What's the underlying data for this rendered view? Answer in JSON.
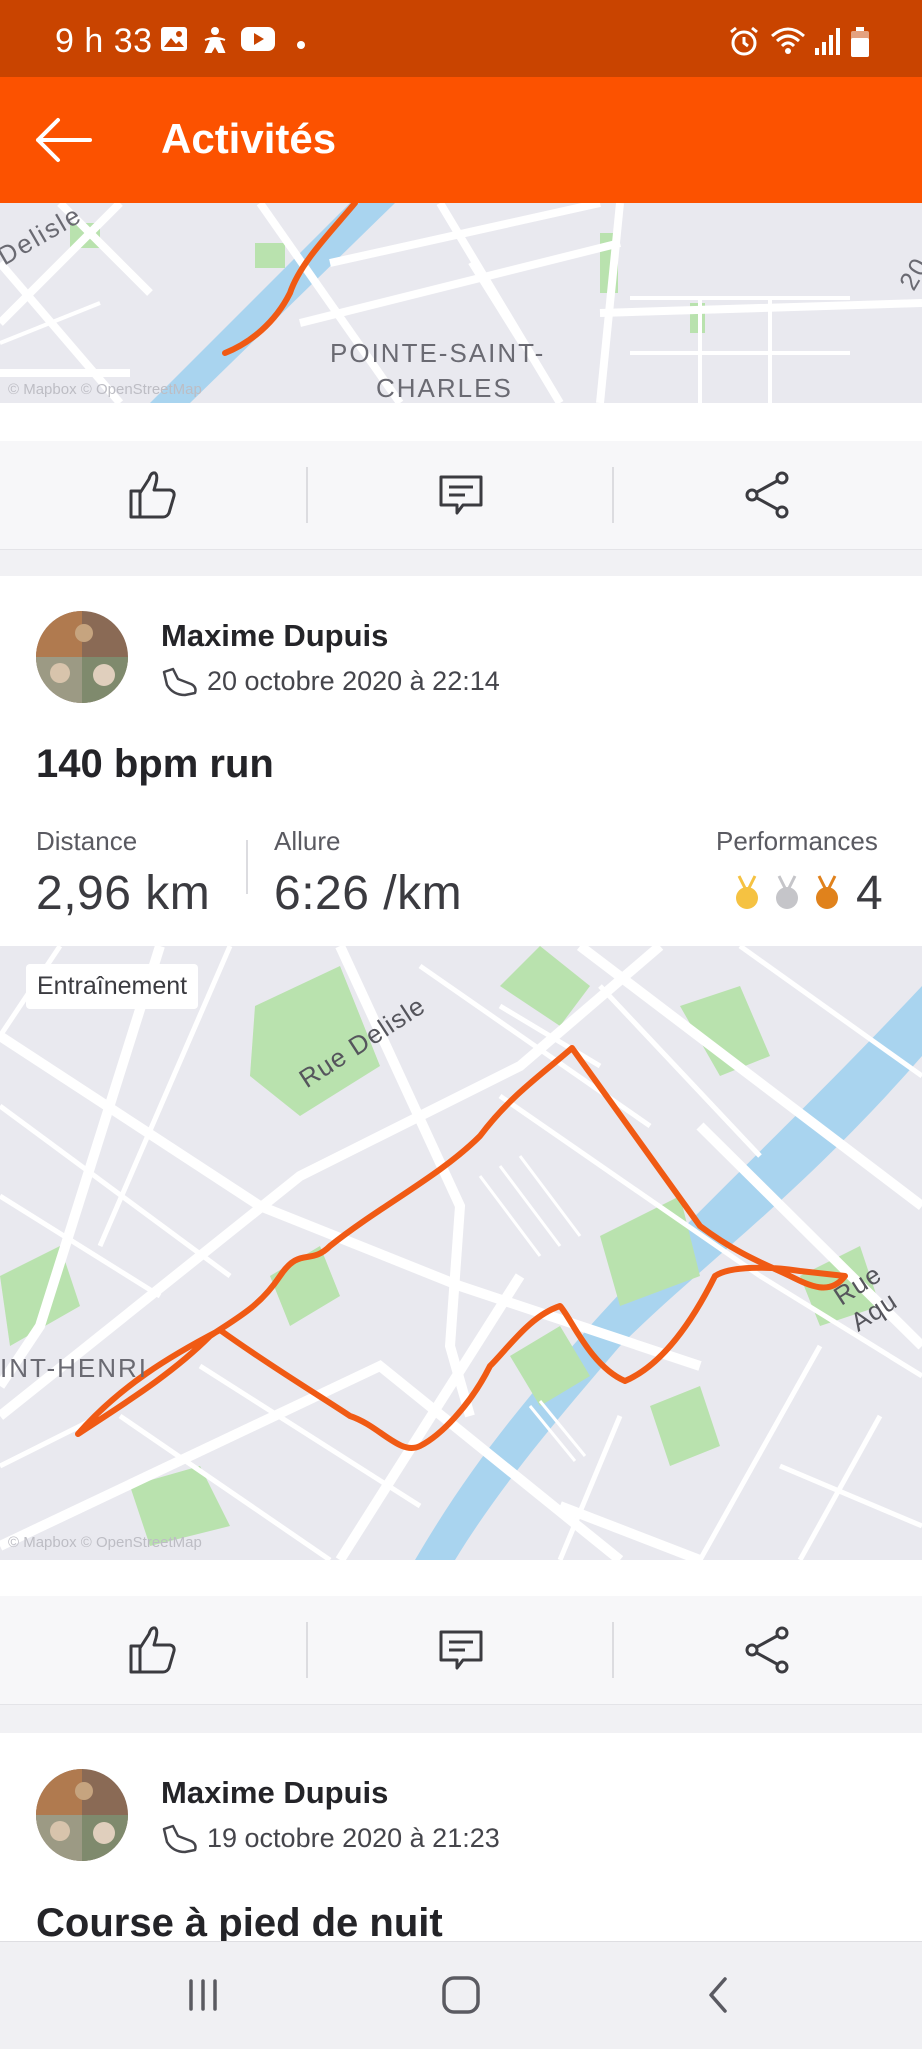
{
  "status_bar": {
    "time": "9 h 33",
    "icons": [
      "image-icon",
      "accessibility-icon",
      "youtube-icon",
      "dot-icon",
      "alarm-icon",
      "wifi-icon",
      "signal-icon",
      "battery-icon"
    ]
  },
  "app_bar": {
    "title": "Activités",
    "back_icon": "arrow-left-icon"
  },
  "map_top": {
    "labels": [
      "Delisle",
      "POINTE-SAINT-",
      "CHARLES",
      "20"
    ],
    "attribution": "© Mapbox © OpenStreetMap"
  },
  "actions": {
    "kudos_icon": "thumbs-up-icon",
    "comment_icon": "comment-icon",
    "share_icon": "share-icon"
  },
  "activity1": {
    "athlete": "Maxime Dupuis",
    "date": "20 octobre 2020 à 22:14",
    "title": "140 bpm run",
    "stats": {
      "distance_label": "Distance",
      "distance_value": "2,96 km",
      "pace_label": "Allure",
      "pace_value": "6:26 /km",
      "perf_label": "Performances",
      "perf_value": "4"
    },
    "map": {
      "badge": "Entraînement",
      "labels": [
        "Rue Delisle",
        "Rue Aqu",
        "INT-HENRI"
      ],
      "attribution": "© Mapbox © OpenStreetMap"
    }
  },
  "activity2": {
    "athlete": "Maxime Dupuis",
    "date": "19 octobre 2020 à 21:23",
    "title": "Course à pied de nuit"
  },
  "colors": {
    "brand": "#fc5200",
    "status_bar": "#c94400",
    "route": "#f05a14",
    "medal_gold": "#f5c242",
    "medal_silver": "#c5c5c9",
    "medal_bronze": "#e0821c"
  },
  "nav_bar": {
    "icons": [
      "recent-apps-icon",
      "home-icon",
      "back-icon"
    ]
  }
}
